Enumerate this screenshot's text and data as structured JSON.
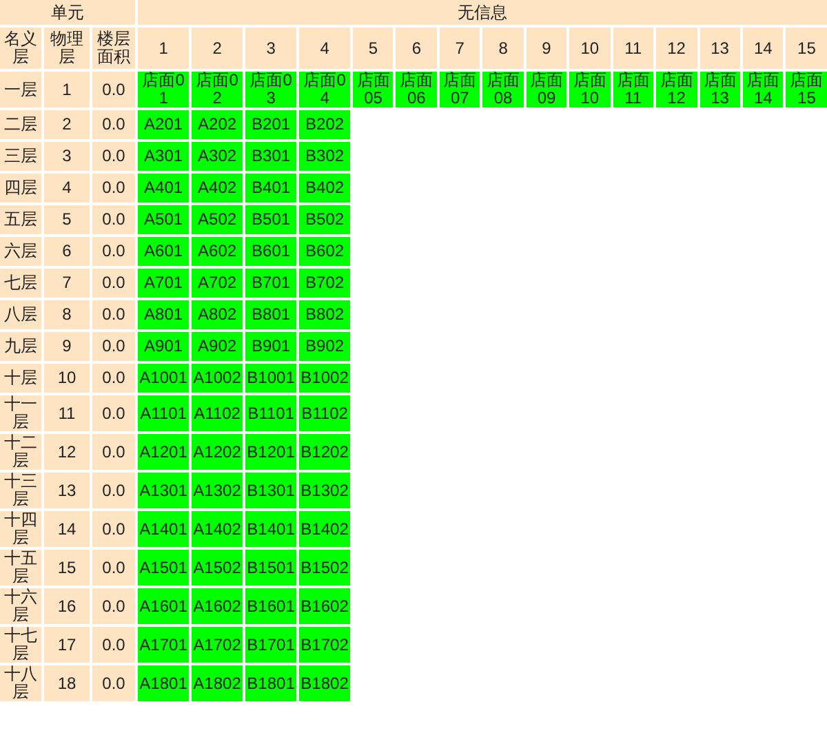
{
  "header": {
    "unit_label": "单元",
    "info_label": "无信息",
    "name_label": "名义层",
    "physical_label": "物理层",
    "area_label": "楼层面积",
    "columns": [
      "1",
      "2",
      "3",
      "4",
      "5",
      "6",
      "7",
      "8",
      "9",
      "10",
      "11",
      "12",
      "13",
      "14",
      "15"
    ]
  },
  "rows": [
    {
      "name": "一层",
      "physical": "1",
      "area": "0.0",
      "units": [
        "店面01",
        "店面02",
        "店面03",
        "店面04",
        "店面05",
        "店面06",
        "店面07",
        "店面08",
        "店面09",
        "店面10",
        "店面11",
        "店面12",
        "店面13",
        "店面14",
        "店面15"
      ]
    },
    {
      "name": "二层",
      "physical": "2",
      "area": "0.0",
      "units": [
        "A201",
        "A202",
        "B201",
        "B202"
      ]
    },
    {
      "name": "三层",
      "physical": "3",
      "area": "0.0",
      "units": [
        "A301",
        "A302",
        "B301",
        "B302"
      ]
    },
    {
      "name": "四层",
      "physical": "4",
      "area": "0.0",
      "units": [
        "A401",
        "A402",
        "B401",
        "B402"
      ]
    },
    {
      "name": "五层",
      "physical": "5",
      "area": "0.0",
      "units": [
        "A501",
        "A502",
        "B501",
        "B502"
      ]
    },
    {
      "name": "六层",
      "physical": "6",
      "area": "0.0",
      "units": [
        "A601",
        "A602",
        "B601",
        "B602"
      ]
    },
    {
      "name": "七层",
      "physical": "7",
      "area": "0.0",
      "units": [
        "A701",
        "A702",
        "B701",
        "B702"
      ]
    },
    {
      "name": "八层",
      "physical": "8",
      "area": "0.0",
      "units": [
        "A801",
        "A802",
        "B801",
        "B802"
      ]
    },
    {
      "name": "九层",
      "physical": "9",
      "area": "0.0",
      "units": [
        "A901",
        "A902",
        "B901",
        "B902"
      ]
    },
    {
      "name": "十层",
      "physical": "10",
      "area": "0.0",
      "units": [
        "A1001",
        "A1002",
        "B1001",
        "B1002"
      ]
    },
    {
      "name": "十一层",
      "physical": "11",
      "area": "0.0",
      "units": [
        "A1101",
        "A1102",
        "B1101",
        "B1102"
      ]
    },
    {
      "name": "十二层",
      "physical": "12",
      "area": "0.0",
      "units": [
        "A1201",
        "A1202",
        "B1201",
        "B1202"
      ]
    },
    {
      "name": "十三层",
      "physical": "13",
      "area": "0.0",
      "units": [
        "A1301",
        "A1302",
        "B1301",
        "B1302"
      ]
    },
    {
      "name": "十四层",
      "physical": "14",
      "area": "0.0",
      "units": [
        "A1401",
        "A1402",
        "B1401",
        "B1402"
      ]
    },
    {
      "name": "十五层",
      "physical": "15",
      "area": "0.0",
      "units": [
        "A1501",
        "A1502",
        "B1501",
        "B1502"
      ]
    },
    {
      "name": "十六层",
      "physical": "16",
      "area": "0.0",
      "units": [
        "A1601",
        "A1602",
        "B1601",
        "B1602"
      ]
    },
    {
      "name": "十七层",
      "physical": "17",
      "area": "0.0",
      "units": [
        "A1701",
        "A1702",
        "B1701",
        "B1702"
      ]
    },
    {
      "name": "十八层",
      "physical": "18",
      "area": "0.0",
      "units": [
        "A1801",
        "A1802",
        "B1801",
        "B1802"
      ]
    }
  ]
}
